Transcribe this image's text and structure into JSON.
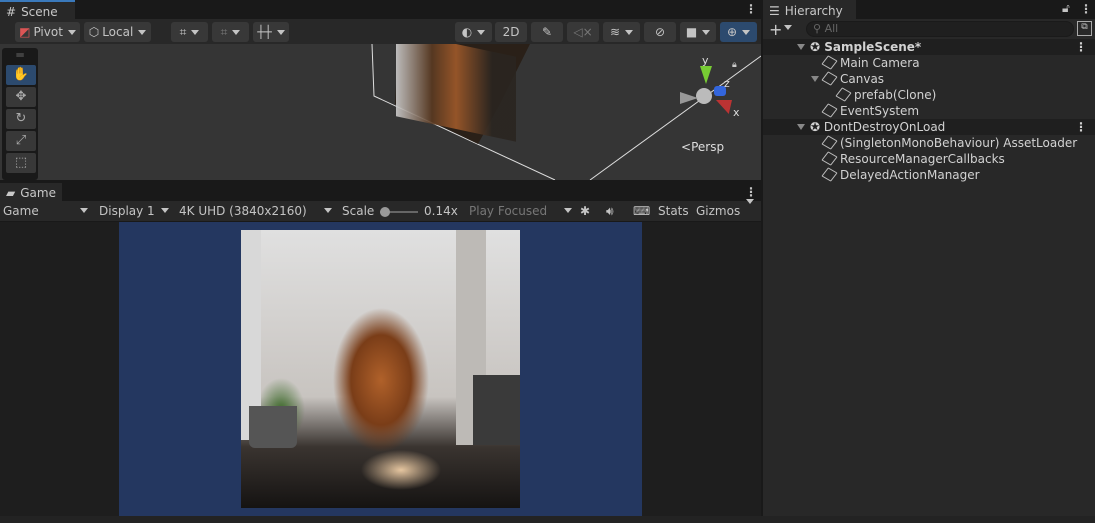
{
  "scene": {
    "tab": "Scene",
    "pivot": "Pivot",
    "local": "Local",
    "btn_2d": "2D",
    "persp": "Persp",
    "axes": {
      "y": "y",
      "z": "z",
      "x": "x"
    }
  },
  "game": {
    "tab": "Game",
    "mode": "Game",
    "display": "Display 1",
    "resolution": "4K UHD (3840x2160)",
    "scale_label": "Scale",
    "scale_value": "0.14x",
    "scale_fraction": 0.0,
    "play_mode": "Play Focused",
    "stats": "Stats",
    "gizmos": "Gizmos"
  },
  "hierarchy": {
    "tab": "Hierarchy",
    "search_placeholder": "All",
    "items": [
      {
        "label": "SampleScene*",
        "kind": "scene"
      },
      {
        "label": "Main Camera"
      },
      {
        "label": "Canvas"
      },
      {
        "label": "prefab(Clone)"
      },
      {
        "label": "EventSystem"
      },
      {
        "label": "DontDestroyOnLoad",
        "kind": "scene"
      },
      {
        "label": "(SingletonMonoBehaviour) AssetLoader"
      },
      {
        "label": "ResourceManagerCallbacks"
      },
      {
        "label": "DelayedActionManager"
      }
    ]
  },
  "colors": {
    "game_bg": "#243760",
    "accent": "#3a5a86"
  }
}
